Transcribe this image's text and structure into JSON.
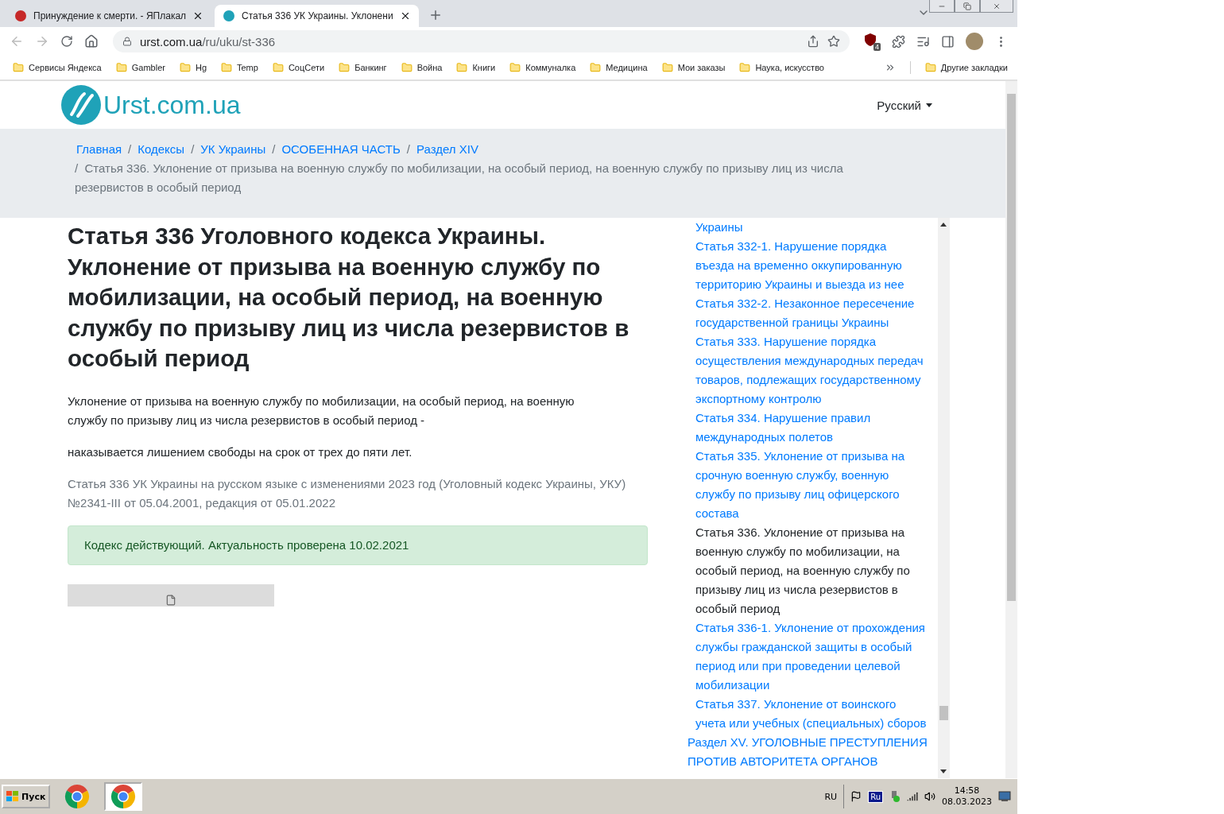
{
  "browser": {
    "tabs": [
      {
        "title": "Принуждение к смерти. - ЯПлакал",
        "selected": false
      },
      {
        "title": "Статья 336 УК Украины. Уклонени",
        "selected": true
      }
    ],
    "host": "urst.com.ua",
    "path": "/ru/uku/st-336",
    "extension_badge": "4",
    "bookmarks": [
      "Сервисы Яндекса",
      "Gambler",
      "Hg",
      "Temp",
      "СоцСети",
      "Банкинг",
      "Война",
      "Книги",
      "Коммуналка",
      "Медицина",
      "Мои заказы",
      "Наука, искусство"
    ],
    "other_bookmarks": "Другие закладки"
  },
  "site": {
    "logo": "Urst.com.ua",
    "language": "Русский"
  },
  "breadcrumb": {
    "separator": "/",
    "links": [
      "Главная",
      "Кодексы",
      "УК Украины",
      "ОСОБЕННАЯ ЧАСТЬ",
      "Раздел XIV"
    ],
    "current": "Статья 336. Уклонение от призыва на военную службу по мобилизации, на особый период, на военную службу по призыву лиц из числа резервистов в особый период"
  },
  "article": {
    "title": "Статья 336 Уголовного кодекса Украины. Уклонение от призыва на военную службу по мобилизации, на особый период, на военную службу по призыву лиц из числа резервистов в особый период",
    "paragraphs": [
      "Уклонение от призыва на военную службу по мобилизации, на особый период, на военную службу по призыву лиц из числа резервистов в особый период -",
      "наказывается лишением свободы на срок от трех до пяти лет."
    ],
    "source": "Статья 336 УК Украины на русском языке с изменениями 2023 год (Уголовный кодекс Украины, УКУ) №2341-III от 05.04.2001, редакция от 05.01.2022",
    "status": "Кодекс действующий. Актуальность проверена 10.02.2021"
  },
  "sidebar": {
    "items": [
      {
        "label": "Украины",
        "selected": false
      },
      {
        "label": "Статья 332-1. Нарушение порядка въезда на временно оккупированную территорию Украины и выезда из нее",
        "selected": false
      },
      {
        "label": "Статья 332-2. Незаконное пересечение государственной границы Украины",
        "selected": false
      },
      {
        "label": "Статья 333. Нарушение порядка осуществления международных передач товаров, подлежащих государственному экспортному контролю",
        "selected": false
      },
      {
        "label": "Статья 334. Нарушение правил международных полетов",
        "selected": false
      },
      {
        "label": "Статья 335. Уклонение от призыва на срочную военную службу, военную службу по призыву лиц офицерского состава",
        "selected": false
      },
      {
        "label": "Статья 336. Уклонение от призыва на военную службу по мобилизации, на особый период, на военную службу по призыву лиц из числа резервистов в особый период",
        "selected": true
      },
      {
        "label": "Статья 336-1. Уклонение от прохождения службы гражданской защиты в особый период или при проведении целевой мобилизации",
        "selected": false
      },
      {
        "label": "Статья 337. Уклонение от воинского учета или учебных (специальных) сборов",
        "selected": false
      }
    ],
    "section": "Раздел XV. УГОЛОВНЫЕ ПРЕСТУПЛЕНИЯ ПРОТИВ АВТОРИТЕТА ОРГАНОВ"
  },
  "taskbar": {
    "start": "Пуск",
    "apps": [
      {
        "selected": false
      },
      {
        "selected": true
      }
    ],
    "language": "RU",
    "tray_language": "Ru",
    "time": "14:58",
    "date": "08.03.2023"
  }
}
